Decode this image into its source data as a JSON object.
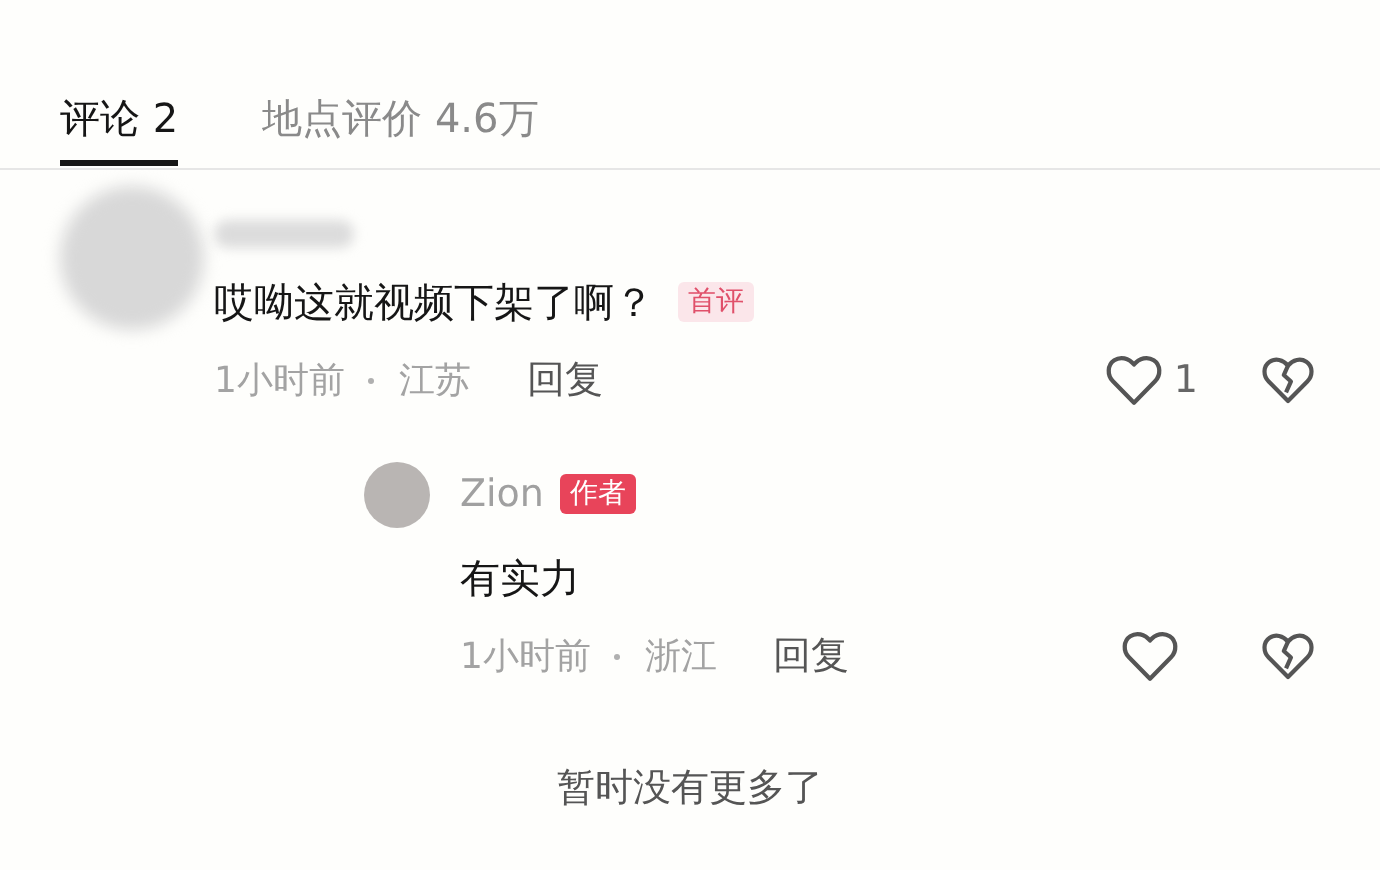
{
  "tabs": [
    {
      "label": "评论 2",
      "selected": true
    },
    {
      "label": "地点评价 4.6万",
      "selected": false
    }
  ],
  "comments": [
    {
      "avatar_blurred": true,
      "name_blurred": true,
      "text": "哎呦这就视频下架了啊？",
      "badge": {
        "kind": "first",
        "label": "首评"
      },
      "time": "1小时前",
      "location": "江苏",
      "reply_label": "回复",
      "likes": "1",
      "children": [
        {
          "avatar_blurred": false,
          "name": "Zion",
          "badge": {
            "kind": "author",
            "label": "作者"
          },
          "text": "有实力",
          "time": "1小时前",
          "location": "浙江",
          "reply_label": "回复"
        }
      ]
    }
  ],
  "footer": "暂时没有更多了"
}
